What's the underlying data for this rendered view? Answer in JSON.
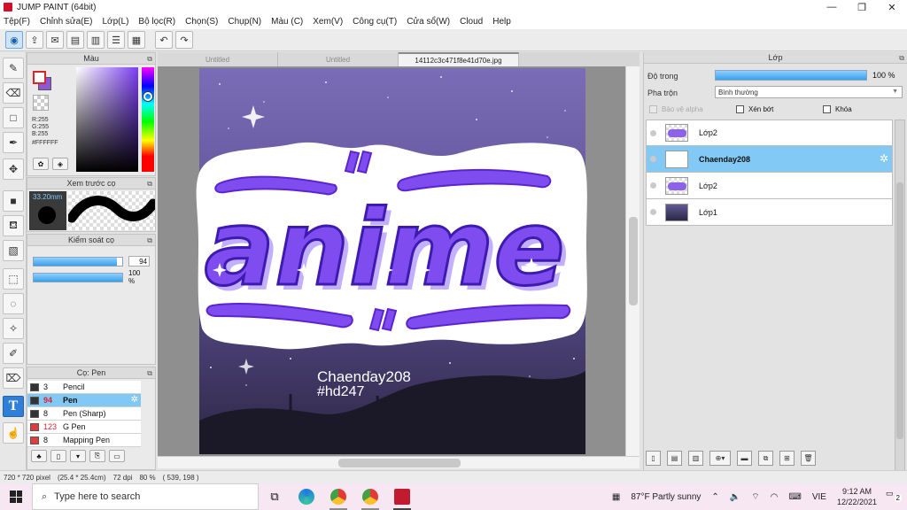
{
  "window": {
    "title": "JUMP PAINT (64bit)",
    "minimize": "—",
    "maximize": "❐",
    "close": "✕"
  },
  "menu": [
    "Tệp(F)",
    "Chỉnh sửa(E)",
    "Lớp(L)",
    "Bộ lọc(R)",
    "Chọn(S)",
    "Chụp(N)",
    "Màu (C)",
    "Xem(V)",
    "Công cụ(T)",
    "Cửa sổ(W)",
    "Cloud",
    "Help"
  ],
  "color_panel": {
    "title": "Màu",
    "r": "R:255",
    "g": "G:255",
    "b": "B:255",
    "hex": "#FFFFFF",
    "fg_color": "#ffffff",
    "bg_color": "#8b59d6"
  },
  "brush_preview": {
    "title": "Xem trước cọ",
    "size": "33.20mm"
  },
  "brush_control": {
    "title": "Kiểm soát cọ",
    "size_value": "94",
    "size_fraction": 0.94,
    "opacity_value": "100 %",
    "opacity_fraction": 1.0
  },
  "brush_panel": {
    "title": "Cọ: Pen",
    "items": [
      {
        "size": "3",
        "name": "Pencil",
        "chip": "#333333"
      },
      {
        "size": "94",
        "name": "Pen",
        "chip": "#333333",
        "selected": true
      },
      {
        "size": "8",
        "name": "Pen (Sharp)",
        "chip": "#333333"
      },
      {
        "size": "123",
        "name": "G Pen",
        "chip": "#e23b3b"
      },
      {
        "size": "8",
        "name": "Mapping Pen",
        "chip": "#e23b3b"
      }
    ]
  },
  "tabs": [
    {
      "label": "Untitled"
    },
    {
      "label": "Untitled"
    },
    {
      "label": "14112c3c471f8e41d70e.jpg",
      "active": true
    }
  ],
  "artwork": {
    "main_word": "anime",
    "caption_line1": "Chaenday208",
    "caption_line2": "#hd247"
  },
  "layers_panel": {
    "title": "Lớp",
    "opacity_label": "Độ trong",
    "opacity_value": "100 %",
    "blend_label": "Pha trộn",
    "blend_value": "Bình thường",
    "checks": [
      "Bảo vệ alpha",
      "Xén bớt",
      "Khóa"
    ],
    "layers": [
      {
        "name": "Lớp2",
        "thumb": "art"
      },
      {
        "name": "Chaenday208",
        "thumb": "text",
        "selected": true
      },
      {
        "name": "Lớp2",
        "thumb": "art"
      },
      {
        "name": "Lớp1",
        "thumb": "photo"
      }
    ]
  },
  "status": {
    "size": "720 * 720 pixel",
    "physical": "(25.4 * 25.4cm)",
    "dpi": "72 dpi",
    "zoom": "80 %",
    "coords": "( 539, 198 )"
  },
  "taskbar": {
    "search_placeholder": "Type here to search",
    "weather": "87°F  Partly sunny",
    "lang": "VIE",
    "time": "9:12 AM",
    "date": "12/22/2021",
    "notifications": "2"
  },
  "colors": {
    "accent": "#2f7fd8",
    "selection": "#83c9f5",
    "art_purple": "#7f4cf0",
    "art_outline": "#5b24d0"
  }
}
